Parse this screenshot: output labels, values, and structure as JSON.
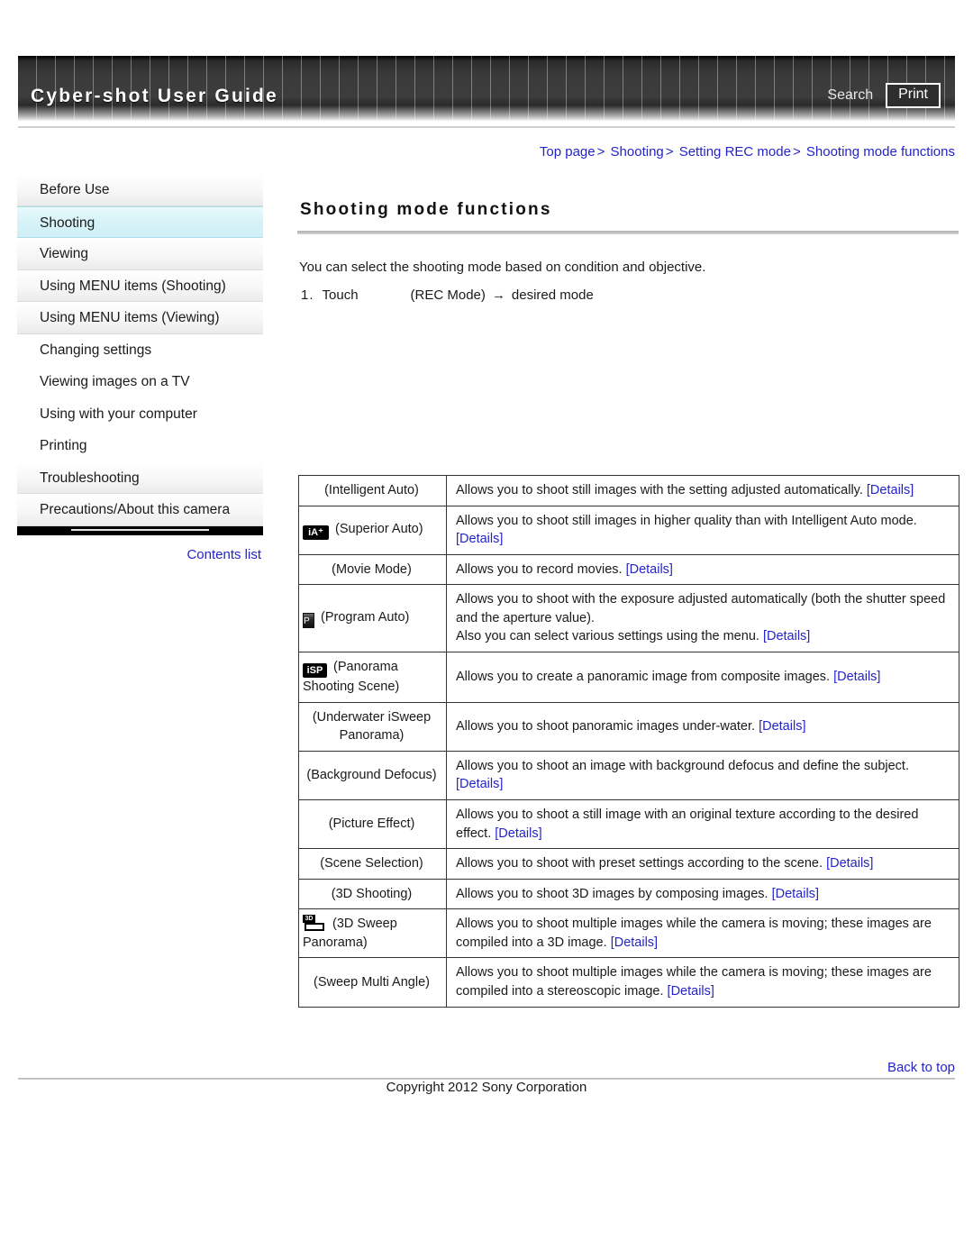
{
  "header": {
    "title": "Cyber-shot User Guide",
    "search_label": "Search",
    "print_label": "Print"
  },
  "breadcrumb": {
    "items": [
      "Top page",
      "Shooting",
      "Setting REC mode",
      "Shooting mode functions"
    ],
    "separator": ">"
  },
  "sidebar": {
    "items": [
      {
        "label": "Before Use",
        "active": false
      },
      {
        "label": "Shooting",
        "active": true
      },
      {
        "label": "Viewing",
        "active": false
      },
      {
        "label": "Using MENU items (Shooting)",
        "active": false
      },
      {
        "label": "Using MENU items (Viewing)",
        "active": false
      },
      {
        "label": "Changing settings",
        "active": false
      },
      {
        "label": "Viewing images on a TV",
        "active": false
      },
      {
        "label": "Using with your computer",
        "active": false
      },
      {
        "label": "Printing",
        "active": false
      },
      {
        "label": "Troubleshooting",
        "active": false
      },
      {
        "label": "Precautions/About this camera",
        "active": false
      }
    ],
    "contents_list_label": "Contents list"
  },
  "main": {
    "page_title": "Shooting mode functions",
    "intro": "You can select the shooting mode based on condition and objective.",
    "step": {
      "number": "1.",
      "action": "Touch",
      "target": "(REC Mode)",
      "arrow": "→",
      "result": "desired mode"
    },
    "rows": [
      {
        "icon": "none",
        "mode": "(Intelligent Auto)",
        "desc_before": "Allows you to shoot still images with the setting adjusted automatically.",
        "desc_mid": "",
        "details": "[Details]",
        "desc_after": ""
      },
      {
        "icon": "superior-auto-icon",
        "icon_text": "iA⁺",
        "mode": "(Superior Auto)",
        "desc_before": "Allows you to shoot still images in higher quality than with Intelligent Auto mode.",
        "details": "[Details]",
        "desc_after": ""
      },
      {
        "icon": "none",
        "mode": "(Movie Mode)",
        "desc_before": "Allows you to record movies.",
        "details": "[Details]",
        "desc_after": ""
      },
      {
        "icon": "program-auto-icon",
        "icon_text": "P",
        "mode": "(Program Auto)",
        "desc_line1": "Allows you to shoot with the exposure adjusted automatically (both the shutter speed and the aperture value).",
        "desc_line2": "Also you can select various settings using the menu.",
        "details": "[Details]",
        "desc_after": ""
      },
      {
        "icon": "panorama-icon",
        "icon_text": "iSP",
        "mode": "(Panorama Shooting Scene)",
        "desc_before": "Allows you to create a panoramic image from composite images.",
        "details": "[Details]",
        "desc_after": ""
      },
      {
        "icon": "none",
        "mode": "(Underwater iSweep Panorama)",
        "desc_before": "Allows you to shoot panoramic images under-water.",
        "details": "[Details]",
        "desc_after": ""
      },
      {
        "icon": "none",
        "mode": "(Background Defocus)",
        "desc_before": "Allows you to shoot an image with background defocus and define the subject.",
        "details": "[Details]",
        "desc_after": ""
      },
      {
        "icon": "none",
        "mode": "(Picture Effect)",
        "desc_before": "Allows you to shoot a still image with an original texture according to the desired effect.",
        "details": "[Details]",
        "desc_after": ""
      },
      {
        "icon": "none",
        "mode": "(Scene Selection)",
        "desc_before": "Allows you to shoot with preset settings according to the scene.",
        "details": "[Details]",
        "desc_after": ""
      },
      {
        "icon": "none",
        "mode": "(3D Shooting)",
        "desc_before": "Allows you to shoot 3D images by composing images.",
        "details": "[Details]",
        "desc_after": ""
      },
      {
        "icon": "sweep-3d-icon",
        "icon_text": "3D",
        "mode": "(3D Sweep Panorama)",
        "desc_before": "Allows you to shoot multiple images while the camera is moving; these images are compiled into a 3D image.",
        "details": "[Details]",
        "desc_after": ""
      },
      {
        "icon": "none",
        "mode": "(Sweep Multi Angle)",
        "desc_before": "Allows you to shoot multiple images while the camera is moving; these images are compiled into a stereoscopic image.",
        "details": "[Details]",
        "desc_after": ""
      }
    ]
  },
  "footer": {
    "back_to_top": "Back to top",
    "copyright": "Copyright 2012 Sony Corporation"
  },
  "colors": {
    "link": "#2424c8",
    "active_nav": "#d7f3f8",
    "header_dark": "#3a3a3a",
    "table_border": "#333333"
  }
}
